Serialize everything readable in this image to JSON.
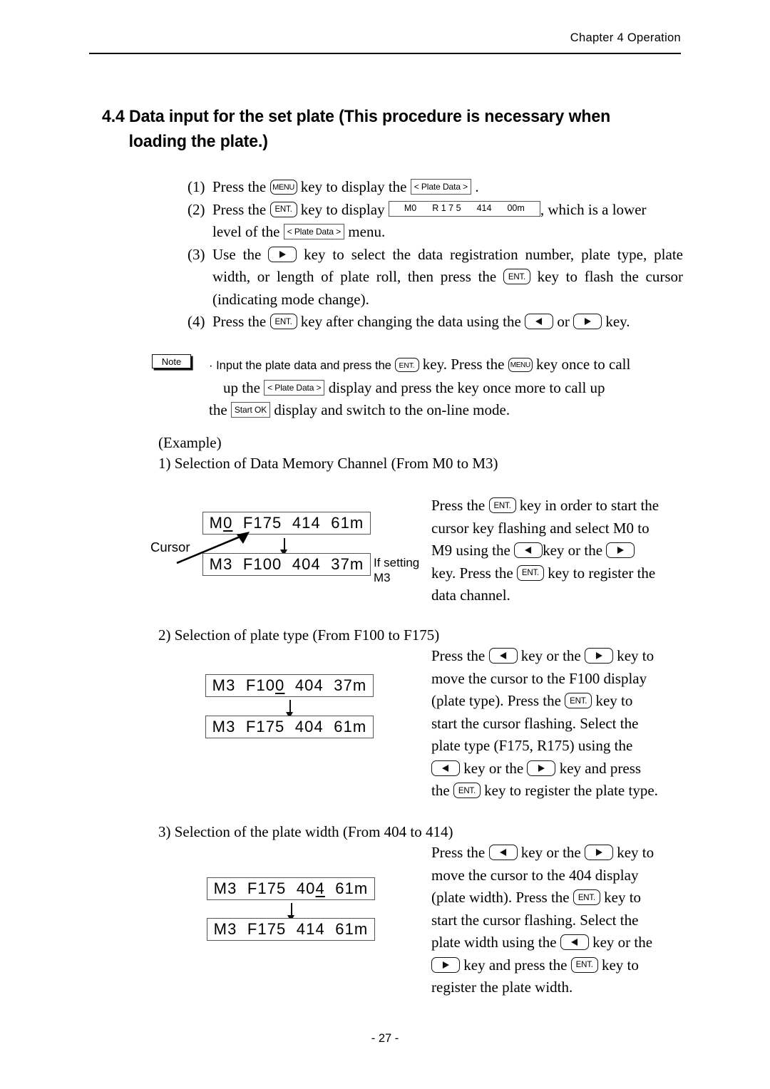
{
  "header": {
    "text": "Chapter 4   Operation"
  },
  "title": {
    "line1": "4.4 Data input for the set plate (This procedure is necessary when",
    "line2": "loading the plate.)"
  },
  "keys": {
    "menu": "MENU",
    "ent": "ENT.",
    "left_icon": "left-arrow-key",
    "right_icon": "right-arrow-key"
  },
  "tags": {
    "plate_data": "< Plate Data >",
    "start_ok": "Start OK"
  },
  "lcd_step2": {
    "ch": "M0",
    "type": "R 1 7 5",
    "width": "414",
    "length": "00m"
  },
  "steps": [
    {
      "num": "(1)",
      "t1": "Press the ",
      "t2": " key to display the ",
      "t3": " ."
    },
    {
      "num": "(2)",
      "t1": "Press the ",
      "t2": " key to display ",
      "t3": ", which is a lower",
      "t4": "level of the ",
      "t5": " menu."
    },
    {
      "num": "(3)",
      "t1": "Use the ",
      "t2": " key to select the data registration number, plate type, plate",
      "t3": "width, or length of plate roll, then press the ",
      "t4": " key to flash the cursor",
      "t5": "(indicating mode change)."
    },
    {
      "num": "(4)",
      "t1": "Press the ",
      "t2": " key after changing the data using the ",
      "t3": " or ",
      "t4": " key."
    }
  ],
  "note": {
    "label": "Note",
    "l1_a": "· Input the plate data and press the ",
    "l1_b": " key. Press the ",
    "l1_c": " key once to call",
    "l2_a": "up the ",
    "l2_b": " display and press the  key once more to call up",
    "l3_a": "the ",
    "l3_b": " display and switch to the on-line mode."
  },
  "example_heading": "(Example)",
  "sections": [
    {
      "heading": "1) Selection of Data Memory Channel  (From M0 to M3)",
      "lcd_top": {
        "pre": "M",
        "cursor": "0",
        "post": "  F175  414  61m"
      },
      "lcd_bottom": "M3  F100  404  37m",
      "cursor_label": "Cursor",
      "side_note_l1": "If setting",
      "side_note_l2": "M3",
      "paragraph": [
        {
          "a": "Press the ",
          "k": "ent",
          "b": " key in order to start the"
        },
        {
          "a": "cursor key flashing and select M0 to"
        },
        {
          "a": "M9 using the ",
          "k": "left",
          "b": "key or the ",
          "k2": "right"
        },
        {
          "a": "key.  Press the ",
          "k": "ent",
          "b": " key to register the"
        },
        {
          "a": "data channel."
        }
      ]
    },
    {
      "heading": "2) Selection of plate type (From F100 to F175)",
      "lcd_top": {
        "pre": "M3  F10",
        "cursor": "0",
        "post": "  404  37m"
      },
      "lcd_bottom": "M3  F175  404  61m",
      "paragraph": [
        {
          "a": "Press the ",
          "k": "left",
          "b": " key or the ",
          "k2": "right",
          "c": " key to"
        },
        {
          "a": "move the cursor to the F100 display"
        },
        {
          "a": "(plate type).  Press the ",
          "k": "ent",
          "b": " key to"
        },
        {
          "a": "start the cursor flashing.  Select the"
        },
        {
          "a": "plate type (F175, R175) using the"
        },
        {
          "k": "left",
          "b": " key or the ",
          "k2": "right",
          "c": " key and press"
        },
        {
          "a": "the ",
          "k": "ent",
          "b": " key to register the plate type."
        }
      ]
    },
    {
      "heading": "3) Selection of the plate width (From 404 to 414)",
      "lcd_top": {
        "pre": "M3  F175  40",
        "cursor": "4",
        "post": "  61m"
      },
      "lcd_bottom": "M3  F175  414  61m",
      "paragraph": [
        {
          "a": "Press the ",
          "k": "left",
          "b": " key or the ",
          "k2": "right",
          "c": " key to"
        },
        {
          "a": "move the cursor to the 404 display"
        },
        {
          "a": "(plate width).  Press the ",
          "k": "ent",
          "b": " key to"
        },
        {
          "a": "start the cursor flashing.  Select the"
        },
        {
          "a": "plate width using the ",
          "k": "left",
          "b": " key or the"
        },
        {
          "k": "right",
          "b": " key and press the ",
          "k2": "ent",
          "c": " key to"
        },
        {
          "a": "register the plate width."
        }
      ]
    }
  ],
  "footer": {
    "page": "- 27 -"
  }
}
